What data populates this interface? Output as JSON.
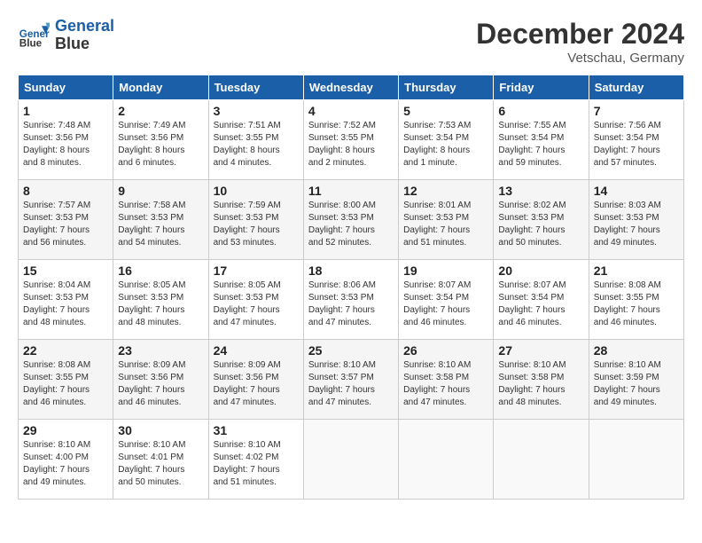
{
  "header": {
    "logo_line1": "General",
    "logo_line2": "Blue",
    "month": "December 2024",
    "location": "Vetschau, Germany"
  },
  "days_of_week": [
    "Sunday",
    "Monday",
    "Tuesday",
    "Wednesday",
    "Thursday",
    "Friday",
    "Saturday"
  ],
  "weeks": [
    [
      {
        "day": "1",
        "info": "Sunrise: 7:48 AM\nSunset: 3:56 PM\nDaylight: 8 hours\nand 8 minutes."
      },
      {
        "day": "2",
        "info": "Sunrise: 7:49 AM\nSunset: 3:56 PM\nDaylight: 8 hours\nand 6 minutes."
      },
      {
        "day": "3",
        "info": "Sunrise: 7:51 AM\nSunset: 3:55 PM\nDaylight: 8 hours\nand 4 minutes."
      },
      {
        "day": "4",
        "info": "Sunrise: 7:52 AM\nSunset: 3:55 PM\nDaylight: 8 hours\nand 2 minutes."
      },
      {
        "day": "5",
        "info": "Sunrise: 7:53 AM\nSunset: 3:54 PM\nDaylight: 8 hours\nand 1 minute."
      },
      {
        "day": "6",
        "info": "Sunrise: 7:55 AM\nSunset: 3:54 PM\nDaylight: 7 hours\nand 59 minutes."
      },
      {
        "day": "7",
        "info": "Sunrise: 7:56 AM\nSunset: 3:54 PM\nDaylight: 7 hours\nand 57 minutes."
      }
    ],
    [
      {
        "day": "8",
        "info": "Sunrise: 7:57 AM\nSunset: 3:53 PM\nDaylight: 7 hours\nand 56 minutes."
      },
      {
        "day": "9",
        "info": "Sunrise: 7:58 AM\nSunset: 3:53 PM\nDaylight: 7 hours\nand 54 minutes."
      },
      {
        "day": "10",
        "info": "Sunrise: 7:59 AM\nSunset: 3:53 PM\nDaylight: 7 hours\nand 53 minutes."
      },
      {
        "day": "11",
        "info": "Sunrise: 8:00 AM\nSunset: 3:53 PM\nDaylight: 7 hours\nand 52 minutes."
      },
      {
        "day": "12",
        "info": "Sunrise: 8:01 AM\nSunset: 3:53 PM\nDaylight: 7 hours\nand 51 minutes."
      },
      {
        "day": "13",
        "info": "Sunrise: 8:02 AM\nSunset: 3:53 PM\nDaylight: 7 hours\nand 50 minutes."
      },
      {
        "day": "14",
        "info": "Sunrise: 8:03 AM\nSunset: 3:53 PM\nDaylight: 7 hours\nand 49 minutes."
      }
    ],
    [
      {
        "day": "15",
        "info": "Sunrise: 8:04 AM\nSunset: 3:53 PM\nDaylight: 7 hours\nand 48 minutes."
      },
      {
        "day": "16",
        "info": "Sunrise: 8:05 AM\nSunset: 3:53 PM\nDaylight: 7 hours\nand 48 minutes."
      },
      {
        "day": "17",
        "info": "Sunrise: 8:05 AM\nSunset: 3:53 PM\nDaylight: 7 hours\nand 47 minutes."
      },
      {
        "day": "18",
        "info": "Sunrise: 8:06 AM\nSunset: 3:53 PM\nDaylight: 7 hours\nand 47 minutes."
      },
      {
        "day": "19",
        "info": "Sunrise: 8:07 AM\nSunset: 3:54 PM\nDaylight: 7 hours\nand 46 minutes."
      },
      {
        "day": "20",
        "info": "Sunrise: 8:07 AM\nSunset: 3:54 PM\nDaylight: 7 hours\nand 46 minutes."
      },
      {
        "day": "21",
        "info": "Sunrise: 8:08 AM\nSunset: 3:55 PM\nDaylight: 7 hours\nand 46 minutes."
      }
    ],
    [
      {
        "day": "22",
        "info": "Sunrise: 8:08 AM\nSunset: 3:55 PM\nDaylight: 7 hours\nand 46 minutes."
      },
      {
        "day": "23",
        "info": "Sunrise: 8:09 AM\nSunset: 3:56 PM\nDaylight: 7 hours\nand 46 minutes."
      },
      {
        "day": "24",
        "info": "Sunrise: 8:09 AM\nSunset: 3:56 PM\nDaylight: 7 hours\nand 47 minutes."
      },
      {
        "day": "25",
        "info": "Sunrise: 8:10 AM\nSunset: 3:57 PM\nDaylight: 7 hours\nand 47 minutes."
      },
      {
        "day": "26",
        "info": "Sunrise: 8:10 AM\nSunset: 3:58 PM\nDaylight: 7 hours\nand 47 minutes."
      },
      {
        "day": "27",
        "info": "Sunrise: 8:10 AM\nSunset: 3:58 PM\nDaylight: 7 hours\nand 48 minutes."
      },
      {
        "day": "28",
        "info": "Sunrise: 8:10 AM\nSunset: 3:59 PM\nDaylight: 7 hours\nand 49 minutes."
      }
    ],
    [
      {
        "day": "29",
        "info": "Sunrise: 8:10 AM\nSunset: 4:00 PM\nDaylight: 7 hours\nand 49 minutes."
      },
      {
        "day": "30",
        "info": "Sunrise: 8:10 AM\nSunset: 4:01 PM\nDaylight: 7 hours\nand 50 minutes."
      },
      {
        "day": "31",
        "info": "Sunrise: 8:10 AM\nSunset: 4:02 PM\nDaylight: 7 hours\nand 51 minutes."
      },
      null,
      null,
      null,
      null
    ]
  ]
}
